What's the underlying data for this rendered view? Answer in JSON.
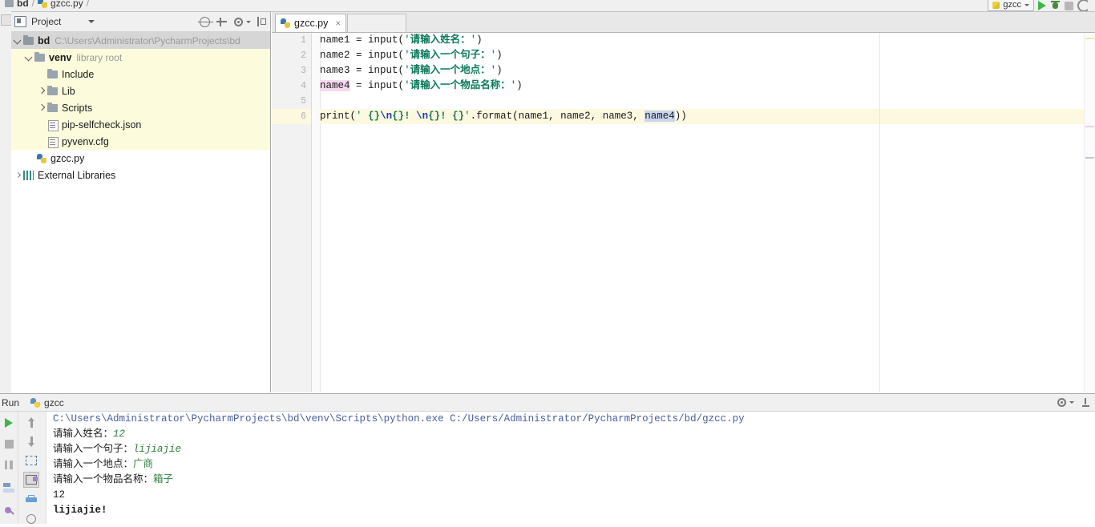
{
  "window": {
    "breadcrumb": {
      "project": "bd",
      "separator": "/",
      "file": "gzcc.py",
      "trailing": "/"
    },
    "run_config": {
      "name": "gzcc"
    }
  },
  "toolbar_right": {
    "run_label": "Run",
    "debug_label": "Debug",
    "stop_label": "Stop",
    "search_label": "Search everywhere"
  },
  "project_panel": {
    "title": "Project",
    "header_icons": [
      "target-icon",
      "collapse-all-icon",
      "gear-icon",
      "hide-icon"
    ],
    "tree": [
      {
        "label": "bd",
        "detail": "C:\\Users\\Administrator\\PycharmProjects\\bd",
        "icon": "folder-icon",
        "arrow": "down",
        "indent": 0,
        "bold": true,
        "selected": true,
        "highlight": false
      },
      {
        "label": "venv",
        "detail": "library root",
        "icon": "folder-icon",
        "arrow": "down",
        "indent": 1,
        "bold": true,
        "selected": false,
        "highlight": true
      },
      {
        "label": "Include",
        "detail": "",
        "icon": "folder-icon",
        "arrow": "none",
        "indent": 2,
        "bold": false,
        "selected": false,
        "highlight": true
      },
      {
        "label": "Lib",
        "detail": "",
        "icon": "folder-icon",
        "arrow": "right",
        "indent": 2,
        "bold": false,
        "selected": false,
        "highlight": true
      },
      {
        "label": "Scripts",
        "detail": "",
        "icon": "folder-icon",
        "arrow": "right",
        "indent": 2,
        "bold": false,
        "selected": false,
        "highlight": true
      },
      {
        "label": "pip-selfcheck.json",
        "detail": "",
        "icon": "json-file-icon",
        "arrow": "none",
        "indent": 2,
        "bold": false,
        "selected": false,
        "highlight": true
      },
      {
        "label": "pyvenv.cfg",
        "detail": "",
        "icon": "cfg-file-icon",
        "arrow": "none",
        "indent": 2,
        "bold": false,
        "selected": false,
        "highlight": true
      },
      {
        "label": "gzcc.py",
        "detail": "",
        "icon": "python-file-icon",
        "arrow": "none",
        "indent": 1,
        "bold": false,
        "selected": false,
        "highlight": false
      },
      {
        "label": "External Libraries",
        "detail": "",
        "icon": "library-icon",
        "arrow": "dot",
        "indent": 0,
        "bold": false,
        "selected": false,
        "highlight": false
      }
    ]
  },
  "editor": {
    "tabs": [
      {
        "label": "gzcc.py",
        "icon": "python-file-icon",
        "close": "×",
        "active": true
      }
    ],
    "line_numbers": [
      "1",
      "2",
      "3",
      "4",
      "5",
      "6"
    ],
    "highlighted_line": 6,
    "lines": [
      {
        "n": 1,
        "text": "name1 = input('请输入姓名：')"
      },
      {
        "n": 2,
        "text": "name2 = input('请输入一个句子：')"
      },
      {
        "n": 3,
        "text": "name3 = input('请输入一个地点：')"
      },
      {
        "n": 4,
        "text": "name4 = input('请输入一个物品名称：')"
      },
      {
        "n": 5,
        "text": ""
      },
      {
        "n": 6,
        "text": "print(' {}\\n{}! \\n{}! {}'.format(name1, name2, name3, name4))"
      }
    ],
    "code_tokens": {
      "l1_var": "name1",
      "l1_eq": " = ",
      "l1_fn": "input",
      "l1_str": "请输入姓名：",
      "l2_var": "name2",
      "l2_str": "请输入一个句子：",
      "l3_var": "name3",
      "l3_str": "请输入一个地点：",
      "l4_var": "name4",
      "l4_str": "请输入一个物品名称：",
      "l6_fn": "print",
      "l6_s1": " {}",
      "l6_esc1": "\\n",
      "l6_s2": "{}! ",
      "l6_esc2": "\\n",
      "l6_s3": "{}! {}",
      "l6_format": ".format",
      "l6_args": "name1, name2, name3, ",
      "l6_arg4": "name4"
    }
  },
  "run_panel": {
    "title": "Run",
    "tab_label": "gzcc",
    "buttons": [
      "rerun-button",
      "stop-button",
      "pause-button",
      "print-button",
      "pin-button"
    ],
    "nav_buttons": [
      "up-arrow-button",
      "down-arrow-button",
      "soft-wrap-button",
      "scroll-to-end-button",
      "print-button",
      "clear-all-button"
    ],
    "header_icons": [
      "gear-icon",
      "hide-icon"
    ],
    "console": [
      {
        "type": "command",
        "text": "C:\\Users\\Administrator\\PycharmProjects\\bd\\venv\\Scripts\\python.exe C:/Users/Administrator/PycharmProjects/bd/gzcc.py"
      },
      {
        "type": "prompt",
        "prompt": "请输入姓名：",
        "input": "12",
        "italic": true
      },
      {
        "type": "prompt",
        "prompt": "请输入一个句子：",
        "input": "lijiajie",
        "italic": true
      },
      {
        "type": "prompt",
        "prompt": "请输入一个地点：",
        "input": "广商",
        "italic": false
      },
      {
        "type": "prompt",
        "prompt": "请输入一个物品名称：",
        "input": "箱子",
        "italic": false
      },
      {
        "type": "output",
        "text": "12"
      },
      {
        "type": "output",
        "text": "lijiajie!"
      }
    ]
  },
  "colors": {
    "string": "#0a7a5a",
    "escape": "#1a3faa",
    "console_command": "#4a5fa0",
    "console_input": "#2f7f3f",
    "tree_highlight": "#fcfbdc",
    "tree_selected": "#d6d6d6",
    "line_highlight": "#fcf9e0",
    "accent_run": "#3cb54a"
  }
}
